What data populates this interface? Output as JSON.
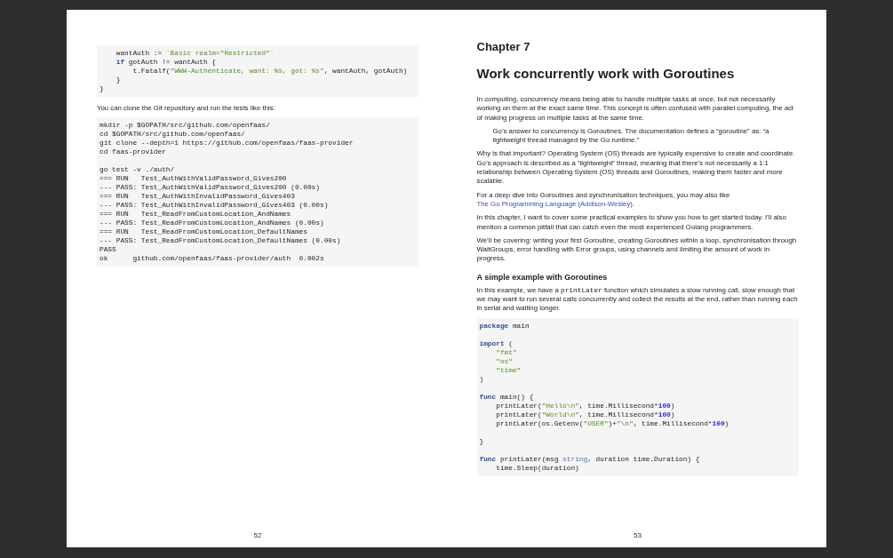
{
  "pages": [
    {
      "number": "52",
      "blocks": [
        {
          "kind": "code",
          "groups": [
            {
              "lines": [
                {
                  "tokens": [
                    {
                      "text": "    wantAuth := ",
                      "kind": "plain"
                    },
                    {
                      "text": "`Basic realm=\"Restricted\"`",
                      "kind": "string"
                    }
                  ]
                },
                {
                  "tokens": [
                    {
                      "text": "    if",
                      "kind": "keyword"
                    },
                    {
                      "text": " gotAuth != wantAuth {",
                      "kind": "plain"
                    }
                  ]
                },
                {
                  "tokens": [
                    {
                      "text": "        t.Fatalf(",
                      "kind": "plain"
                    },
                    {
                      "text": "\"WWW-Authenticate, want: %s, got: %s\"",
                      "kind": "string"
                    },
                    {
                      "text": ", wantAuth, gotAuth)",
                      "kind": "plain"
                    }
                  ]
                },
                {
                  "tokens": [
                    {
                      "text": "    }",
                      "kind": "plain"
                    }
                  ]
                },
                {
                  "tokens": [
                    {
                      "text": "}",
                      "kind": "plain"
                    }
                  ]
                }
              ]
            }
          ]
        },
        {
          "kind": "paragraph",
          "segments": [
            {
              "text": "You can clone the Git repository and run the tests like this:",
              "kind": "text"
            }
          ]
        },
        {
          "kind": "code",
          "groups": [
            {
              "lines": [
                {
                  "tokens": [
                    {
                      "text": "mkdir -p $GOPATH/src/github.com/openfaas/",
                      "kind": "plain"
                    }
                  ]
                },
                {
                  "tokens": [
                    {
                      "text": "cd $GOPATH/src/github.com/openfaas/",
                      "kind": "plain"
                    }
                  ]
                },
                {
                  "tokens": [
                    {
                      "text": "git clone --depth=1 https://github.com/openfaas/faas-provider",
                      "kind": "plain"
                    }
                  ]
                },
                {
                  "tokens": [
                    {
                      "text": "cd faas-provider",
                      "kind": "plain"
                    }
                  ]
                }
              ]
            },
            {
              "lines": [
                {
                  "tokens": [
                    {
                      "text": "go test -v ./auth/",
                      "kind": "plain"
                    }
                  ]
                },
                {
                  "tokens": [
                    {
                      "text": "=== RUN   Test_AuthWithValidPassword_Gives200",
                      "kind": "plain"
                    }
                  ]
                },
                {
                  "tokens": [
                    {
                      "text": "--- PASS: Test_AuthWithValidPassword_Gives200 (0.00s)",
                      "kind": "plain"
                    }
                  ]
                },
                {
                  "tokens": [
                    {
                      "text": "=== RUN   Test_AuthWithInvalidPassword_Gives403",
                      "kind": "plain"
                    }
                  ]
                },
                {
                  "tokens": [
                    {
                      "text": "--- PASS: Test_AuthWithInvalidPassword_Gives403 (0.00s)",
                      "kind": "plain"
                    }
                  ]
                },
                {
                  "tokens": [
                    {
                      "text": "=== RUN   Test_ReadFromCustomLocation_AndNames",
                      "kind": "plain"
                    }
                  ]
                },
                {
                  "tokens": [
                    {
                      "text": "--- PASS: Test_ReadFromCustomLocation_AndNames (0.00s)",
                      "kind": "plain"
                    }
                  ]
                },
                {
                  "tokens": [
                    {
                      "text": "=== RUN   Test_ReadFromCustomLocation_DefaultNames",
                      "kind": "plain"
                    }
                  ]
                },
                {
                  "tokens": [
                    {
                      "text": "--- PASS: Test_ReadFromCustomLocation_DefaultNames (0.00s)",
                      "kind": "plain"
                    }
                  ]
                },
                {
                  "tokens": [
                    {
                      "text": "PASS",
                      "kind": "plain"
                    }
                  ]
                },
                {
                  "tokens": [
                    {
                      "text": "ok      github.com/openfaas/faas-provider/auth  0.002s",
                      "kind": "plain"
                    }
                  ]
                }
              ]
            }
          ]
        }
      ]
    },
    {
      "number": "53",
      "blocks": [
        {
          "kind": "chapter_label",
          "text": "Chapter 7"
        },
        {
          "kind": "title",
          "text": "Work concurrently work with Goroutines"
        },
        {
          "kind": "paragraph",
          "segments": [
            {
              "text": "In computing, concurrency means being able to handle multiple tasks at once, but not necessarily working on them at the exact same time.  This concept is often confused with parallel computing, the act of making progress on multiple tasks at the same time.",
              "kind": "text"
            }
          ]
        },
        {
          "kind": "quote",
          "text": "Go’s answer to concurrency is Goroutines.  The documentation defines a “goroutine” as:  “a lightweight thread managed by the Go runtime.”"
        },
        {
          "kind": "paragraph",
          "segments": [
            {
              "text": "Why is that important? Operating System (OS) threads are typically expensive to create and coordinate.  Go’s approach is described as a “lightweight” thread, meaning that there’s not necessarily a 1:1 relationship between Operating System (OS) threads and Goroutines, making them faster and more scalable.",
              "kind": "text"
            }
          ]
        },
        {
          "kind": "paragraph",
          "segments": [
            {
              "text": "For a deep dive into Goroutines and synchronisation techniques, you may also like ",
              "kind": "text"
            },
            {
              "text": "The Go Programming Language ",
              "kind": "link"
            },
            {
              "text": "(Addison-Wesley)",
              "kind": "link"
            },
            {
              "text": ".",
              "kind": "text"
            }
          ]
        },
        {
          "kind": "paragraph",
          "segments": [
            {
              "text": "In this chapter, I want to cover some practical examples to show you how to get started today.  I’ll also mention a common pitfall that can catch even the most experienced Golang programmers.",
              "kind": "text"
            }
          ]
        },
        {
          "kind": "paragraph",
          "segments": [
            {
              "text": "We’ll be covering: writing your first Goroutine, creating Goroutines within a loop, synchronisation through WaitGroups, error handling with Error groups, using channels and limiting the amount of work in progress.",
              "kind": "text"
            }
          ]
        },
        {
          "kind": "heading",
          "text": "A simple example with Goroutines"
        },
        {
          "kind": "paragraph",
          "segments": [
            {
              "text": "In this example, we have a ",
              "kind": "text"
            },
            {
              "text": "printLater",
              "kind": "code"
            },
            {
              "text": " function which simulates a slow running call, slow enough that we may want to run several calls concurrently and collect the results at the end, rather than running each in serial and waiting longer.",
              "kind": "text"
            }
          ]
        },
        {
          "kind": "code",
          "groups": [
            {
              "lines": [
                {
                  "tokens": [
                    {
                      "text": "package",
                      "kind": "keyword"
                    },
                    {
                      "text": " main",
                      "kind": "plain"
                    }
                  ]
                }
              ]
            },
            {
              "lines": [
                {
                  "tokens": [
                    {
                      "text": "import",
                      "kind": "keyword"
                    },
                    {
                      "text": " (",
                      "kind": "plain"
                    }
                  ]
                },
                {
                  "tokens": [
                    {
                      "text": "    \"fmt\"",
                      "kind": "string"
                    }
                  ]
                },
                {
                  "tokens": [
                    {
                      "text": "    \"os\"",
                      "kind": "string"
                    }
                  ]
                },
                {
                  "tokens": [
                    {
                      "text": "    \"time\"",
                      "kind": "string"
                    }
                  ]
                },
                {
                  "tokens": [
                    {
                      "text": ")",
                      "kind": "plain"
                    }
                  ]
                }
              ]
            },
            {
              "lines": [
                {
                  "tokens": [
                    {
                      "text": "func",
                      "kind": "keyword"
                    },
                    {
                      "text": " main() {",
                      "kind": "plain"
                    }
                  ]
                },
                {
                  "tokens": [
                    {
                      "text": "    printLater(",
                      "kind": "plain"
                    },
                    {
                      "text": "\"Hello\\n\"",
                      "kind": "string"
                    },
                    {
                      "text": ", time.Millisecond*",
                      "kind": "plain"
                    },
                    {
                      "text": "100",
                      "kind": "number"
                    },
                    {
                      "text": ")",
                      "kind": "plain"
                    }
                  ]
                },
                {
                  "tokens": [
                    {
                      "text": "    printLater(",
                      "kind": "plain"
                    },
                    {
                      "text": "\"World\\n\"",
                      "kind": "string"
                    },
                    {
                      "text": ", time.Millisecond*",
                      "kind": "plain"
                    },
                    {
                      "text": "100",
                      "kind": "number"
                    },
                    {
                      "text": ")",
                      "kind": "plain"
                    }
                  ]
                },
                {
                  "tokens": [
                    {
                      "text": "    printLater(os.Getenv(",
                      "kind": "plain"
                    },
                    {
                      "text": "\"USER\"",
                      "kind": "string"
                    },
                    {
                      "text": ")+",
                      "kind": "plain"
                    },
                    {
                      "text": "\"\\n\"",
                      "kind": "string"
                    },
                    {
                      "text": ", time.Millisecond*",
                      "kind": "plain"
                    },
                    {
                      "text": "100",
                      "kind": "number"
                    },
                    {
                      "text": ")",
                      "kind": "plain"
                    }
                  ]
                }
              ]
            },
            {
              "lines": [
                {
                  "tokens": [
                    {
                      "text": "}",
                      "kind": "plain"
                    }
                  ]
                }
              ]
            },
            {
              "lines": [
                {
                  "tokens": [
                    {
                      "text": "func",
                      "kind": "keyword"
                    },
                    {
                      "text": " printLater(msg ",
                      "kind": "plain"
                    },
                    {
                      "text": "string",
                      "kind": "type"
                    },
                    {
                      "text": ", duration time.Duration) {",
                      "kind": "plain"
                    }
                  ]
                },
                {
                  "tokens": [
                    {
                      "text": "    time.Sleep(duration)",
                      "kind": "plain"
                    }
                  ]
                }
              ]
            }
          ]
        }
      ]
    }
  ]
}
